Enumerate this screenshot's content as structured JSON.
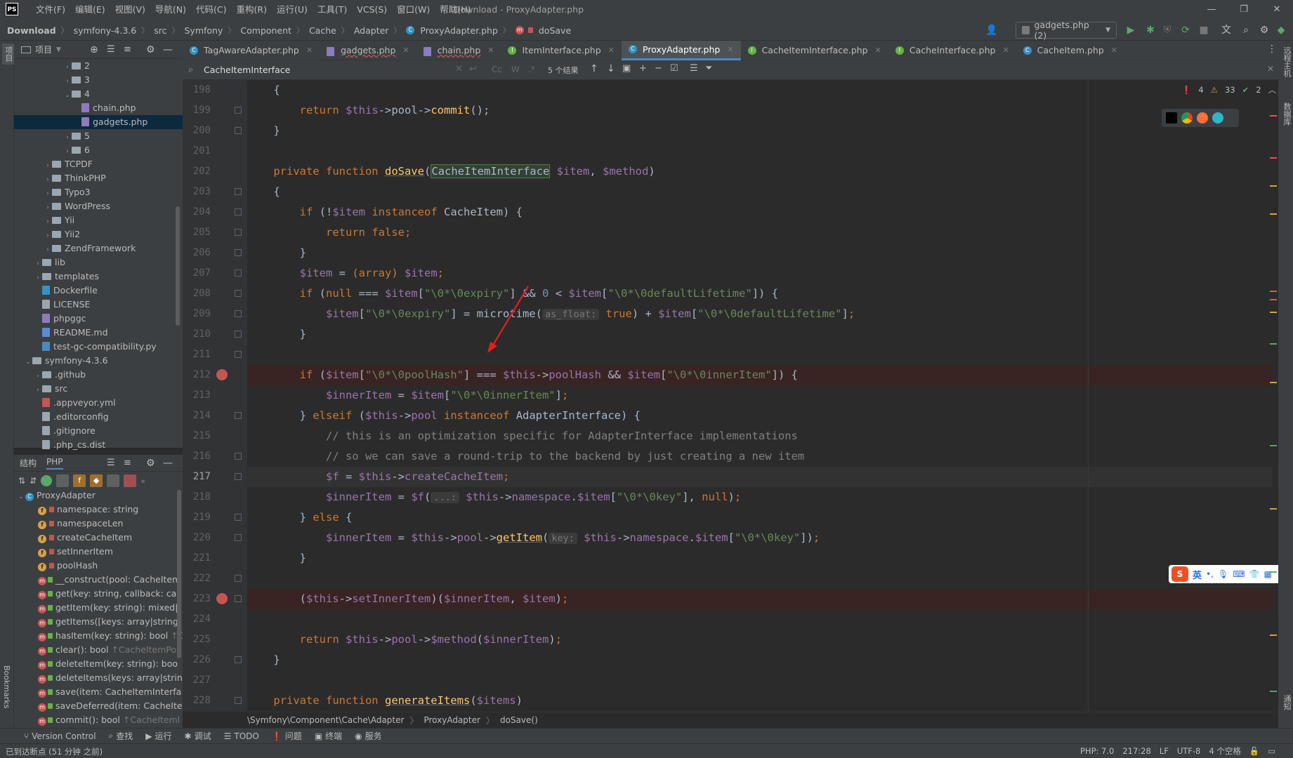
{
  "menubar": {
    "items": [
      "文件(F)",
      "编辑(E)",
      "视图(V)",
      "导航(N)",
      "代码(C)",
      "重构(R)",
      "运行(U)",
      "工具(T)",
      "VCS(S)",
      "窗口(W)",
      "帮助(H)"
    ],
    "window_title": "Download - ProxyAdapter.php"
  },
  "navbar": {
    "crumbs": [
      "Download",
      "symfony-4.3.6",
      "src",
      "Symfony",
      "Component",
      "Cache",
      "Adapter",
      "ProxyAdapter.php",
      "doSave"
    ],
    "run_config": "gadgets.php (2)"
  },
  "project": {
    "title": "项目",
    "tree": [
      {
        "label": "2",
        "type": "folder",
        "depth": 5,
        "arrow": "›"
      },
      {
        "label": "3",
        "type": "folder",
        "depth": 5,
        "arrow": "›"
      },
      {
        "label": "4",
        "type": "folder",
        "depth": 5,
        "arrow": "⌄"
      },
      {
        "label": "chain.php",
        "type": "php",
        "depth": 6,
        "arrow": ""
      },
      {
        "label": "gadgets.php",
        "type": "php",
        "depth": 6,
        "arrow": "",
        "selected": true
      },
      {
        "label": "5",
        "type": "folder",
        "depth": 5,
        "arrow": "›"
      },
      {
        "label": "6",
        "type": "folder",
        "depth": 5,
        "arrow": "›"
      },
      {
        "label": "TCPDF",
        "type": "folder",
        "depth": 3,
        "arrow": "›"
      },
      {
        "label": "ThinkPHP",
        "type": "folder",
        "depth": 3,
        "arrow": "›"
      },
      {
        "label": "Typo3",
        "type": "folder",
        "depth": 3,
        "arrow": "›"
      },
      {
        "label": "WordPress",
        "type": "folder",
        "depth": 3,
        "arrow": "›"
      },
      {
        "label": "Yii",
        "type": "folder",
        "depth": 3,
        "arrow": "›"
      },
      {
        "label": "Yii2",
        "type": "folder",
        "depth": 3,
        "arrow": "›"
      },
      {
        "label": "ZendFramework",
        "type": "folder",
        "depth": 3,
        "arrow": "›"
      },
      {
        "label": "lib",
        "type": "folder",
        "depth": 2,
        "arrow": "›"
      },
      {
        "label": "templates",
        "type": "folder",
        "depth": 2,
        "arrow": "›"
      },
      {
        "label": "Dockerfile",
        "type": "docker",
        "depth": 2,
        "arrow": ""
      },
      {
        "label": "LICENSE",
        "type": "text",
        "depth": 2,
        "arrow": ""
      },
      {
        "label": "phpggc",
        "type": "php",
        "depth": 2,
        "arrow": ""
      },
      {
        "label": "README.md",
        "type": "md",
        "depth": 2,
        "arrow": ""
      },
      {
        "label": "test-gc-compatibility.py",
        "type": "py",
        "depth": 2,
        "arrow": ""
      },
      {
        "label": "symfony-4.3.6",
        "type": "folder",
        "depth": 1,
        "arrow": "⌄"
      },
      {
        "label": ".github",
        "type": "folder",
        "depth": 2,
        "arrow": "›"
      },
      {
        "label": "src",
        "type": "folder",
        "depth": 2,
        "arrow": "›"
      },
      {
        "label": ".appveyor.yml",
        "type": "yml",
        "depth": 2,
        "arrow": ""
      },
      {
        "label": ".editorconfig",
        "type": "gear",
        "depth": 2,
        "arrow": ""
      },
      {
        "label": ".gitignore",
        "type": "text",
        "depth": 2,
        "arrow": ""
      },
      {
        "label": ".php_cs.dist",
        "type": "text",
        "depth": 2,
        "arrow": ""
      }
    ]
  },
  "structure": {
    "tabs": [
      "结构",
      "PHP"
    ],
    "class_name": "ProxyAdapter",
    "members": [
      {
        "kind": "f",
        "label": "namespace: string",
        "dim": ""
      },
      {
        "kind": "f",
        "label": "namespaceLen",
        "dim": ""
      },
      {
        "kind": "f",
        "label": "createCacheItem",
        "dim": ""
      },
      {
        "kind": "f",
        "label": "setInnerItem",
        "dim": ""
      },
      {
        "kind": "f",
        "label": "poolHash",
        "dim": ""
      },
      {
        "kind": "m",
        "label": "__construct(pool: CacheItem",
        "dim": ""
      },
      {
        "kind": "m",
        "label": "get(key: string, callback: cal",
        "dim": ""
      },
      {
        "kind": "m",
        "label": "getItem(key: string): mixed|",
        "dim": ""
      },
      {
        "kind": "m",
        "label": "getItems([keys: array|string|",
        "dim": ""
      },
      {
        "kind": "m",
        "label": "hasItem(key: string): bool",
        "dim": "↑CacheItemPo"
      },
      {
        "kind": "m",
        "label": "clear(): bool",
        "dim": "↑CacheItemPoo"
      },
      {
        "kind": "m",
        "label": "deleteItem(key: string): boo",
        "dim": ""
      },
      {
        "kind": "m",
        "label": "deleteItems(keys: array|strin",
        "dim": ""
      },
      {
        "kind": "m",
        "label": "save(item: CacheItemInterfa",
        "dim": ""
      },
      {
        "kind": "m",
        "label": "saveDeferred(item: CacheIte",
        "dim": ""
      },
      {
        "kind": "m",
        "label": "commit(): bool",
        "dim": "↑CacheIteml"
      }
    ]
  },
  "tabs": [
    {
      "label": "TagAwareAdapter.php",
      "icon": "c",
      "active": false
    },
    {
      "label": "gadgets.php",
      "icon": "php",
      "active": false
    },
    {
      "label": "chain.php",
      "icon": "php",
      "active": false
    },
    {
      "label": "ItemInterface.php",
      "icon": "i",
      "active": false
    },
    {
      "label": "ProxyAdapter.php",
      "icon": "c",
      "active": true
    },
    {
      "label": "CacheItemInterface.php",
      "icon": "i",
      "active": false
    },
    {
      "label": "CacheInterface.php",
      "icon": "i",
      "active": false
    },
    {
      "label": "CacheItem.php",
      "icon": "c",
      "active": false
    }
  ],
  "search": {
    "query": "CacheItemInterface",
    "result_count": "5 个结果",
    "opt_cc": "Cc",
    "opt_w": "W",
    "opt_re": ".*"
  },
  "inspections": {
    "errors": "4",
    "warnings": "33",
    "ok": "2"
  },
  "gutter": {
    "lines": [
      "198",
      "199",
      "200",
      "201",
      "202",
      "203",
      "204",
      "205",
      "206",
      "207",
      "208",
      "209",
      "210",
      "211",
      "212",
      "213",
      "214",
      "215",
      "216",
      "217",
      "218",
      "219",
      "220",
      "221",
      "222",
      "223",
      "224",
      "225",
      "226",
      "227",
      "228"
    ],
    "breakpoints": [
      "212",
      "223"
    ],
    "current": "217"
  },
  "code": {
    "l198": "{",
    "l199_ret": "return",
    "l199_var": "$this",
    "l199_rest": "->pool->",
    "l199_fn": "commit",
    "l199_end": "();",
    "l200": "}",
    "l202_kw": "private function",
    "l202_fn": "doSave",
    "l202_type": "CacheItemInterface",
    "l202_p1": "$item",
    "l202_p2": "$method",
    "l204_if": "if",
    "l204_var": "$item",
    "l204_inst": "instanceof",
    "l204_cls": "CacheItem",
    "l205_ret": "return",
    "l205_false": "false",
    "l207_var": "$item",
    "l207_cast": "(array)",
    "l208_null": "null",
    "l208_key1": "\"\\0*\\0expiry\"",
    "l208_zero": "0",
    "l208_key2": "\"\\0*\\0defaultLifetime\"",
    "l209_fn": "microtime",
    "l209_hint": "as_float:",
    "l209_true": "true",
    "l212_key1": "\"\\0*\\0poolHash\"",
    "l212_prop": "poolHash",
    "l212_key2": "\"\\0*\\0innerItem\"",
    "l213_var": "$innerItem",
    "l213_key": "\"\\0*\\0innerItem\"",
    "l214_else": "elseif",
    "l214_cls": "AdapterInterface",
    "l215_cmt": "// this is an optimization specific for AdapterInterface implementations",
    "l216_cmt": "// so we can save a round-trip to the backend by just creating a new item",
    "l217_var": "$f",
    "l217_prop": "createCacheItem",
    "l218_hint": "...:",
    "l218_prop": "namespace",
    "l218_key": "\"\\0*\\0key\"",
    "l218_null": "null",
    "l219_else": "else",
    "l220_fn": "getItem",
    "l220_hint": "key:",
    "l220_key": "\"\\0*\\0key\"",
    "l223_prop": "setInnerItem",
    "l225_method": "$method",
    "l228_kw": "private function",
    "l228_fn": "generateItems",
    "l228_param": "$items"
  },
  "breadcrumb_bar": [
    "\\Symfony\\Component\\Cache\\Adapter",
    "ProxyAdapter",
    "doSave()"
  ],
  "bottom_tools": [
    "Version Control",
    "查找",
    "运行",
    "调试",
    "TODO",
    "问题",
    "终端",
    "服务"
  ],
  "status": {
    "left": "已到达断点 (51 分钟 之前)",
    "php": "PHP: 7.0",
    "pos": "217:28",
    "le": "LF",
    "enc": "UTF-8",
    "indent": "4 个空格"
  },
  "left_strip": {
    "project": "项目",
    "bookmarks": "Bookmarks",
    "structure": "结构"
  },
  "right_strip": {
    "remote": "远程主机",
    "db": "数据库",
    "notify": "通知"
  },
  "ime": {
    "lang": "英"
  },
  "colors": {
    "accent": "#4a88c7",
    "breakpoint": "#c75450",
    "bg": "#2b2b2b"
  }
}
